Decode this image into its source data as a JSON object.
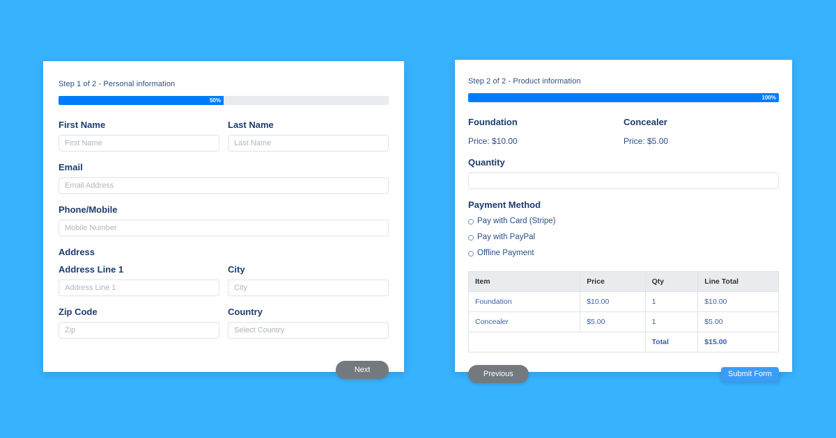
{
  "theme": {
    "page_background": "#37b2fd",
    "progress_fill": "#017bfe",
    "primary_button": "#3b9cf5",
    "secondary_button": "#74797f",
    "label_color": "#1c3c6e",
    "table_header_background": "#e9ecef"
  },
  "step1": {
    "step_text": "Step 1 of 2 - Personal information",
    "progress": {
      "percent": 50,
      "label": "50%"
    },
    "fields": {
      "first_name": {
        "label": "First Name",
        "placeholder": "First Name",
        "value": ""
      },
      "last_name": {
        "label": "Last Name",
        "placeholder": "Last Name",
        "value": ""
      },
      "email": {
        "label": "Email",
        "placeholder": "Email Address",
        "value": ""
      },
      "phone": {
        "label": "Phone/Mobile",
        "placeholder": "Mobile Number",
        "value": ""
      },
      "address_section": {
        "label": "Address"
      },
      "address_line_1": {
        "label": "Address Line 1",
        "placeholder": "Address Line 1",
        "value": ""
      },
      "city": {
        "label": "City",
        "placeholder": "City",
        "value": ""
      },
      "zip": {
        "label": "Zip Code",
        "placeholder": "Zip",
        "value": ""
      },
      "country": {
        "label": "Country",
        "placeholder": "Select Country",
        "value": ""
      }
    },
    "buttons": {
      "next": "Next"
    }
  },
  "step2": {
    "step_text": "Step 2 of 2 - Product information",
    "progress": {
      "percent": 100,
      "label": "100%"
    },
    "products": [
      {
        "name": "Foundation",
        "price_text": "Price: $10.00"
      },
      {
        "name": "Concealer",
        "price_text": "Price: $5.00"
      }
    ],
    "quantity": {
      "label": "Quantity",
      "placeholder": "",
      "value": ""
    },
    "payment": {
      "label": "Payment Method",
      "options": [
        {
          "label": "Pay with Card (Stripe)",
          "selected": false
        },
        {
          "label": "Pay with PayPal",
          "selected": false
        },
        {
          "label": "Offline Payment",
          "selected": false
        }
      ]
    },
    "summary_table": {
      "headers": [
        "Item",
        "Price",
        "Qty",
        "Line Total"
      ],
      "rows": [
        [
          "Foundation",
          "$10.00",
          "1",
          "$10.00"
        ],
        [
          "Concealer",
          "$5.00",
          "1",
          "$5.00"
        ]
      ],
      "total_label": "Total",
      "total_value": "$15.00"
    },
    "buttons": {
      "previous": "Previous",
      "submit": "Submit Form"
    }
  }
}
